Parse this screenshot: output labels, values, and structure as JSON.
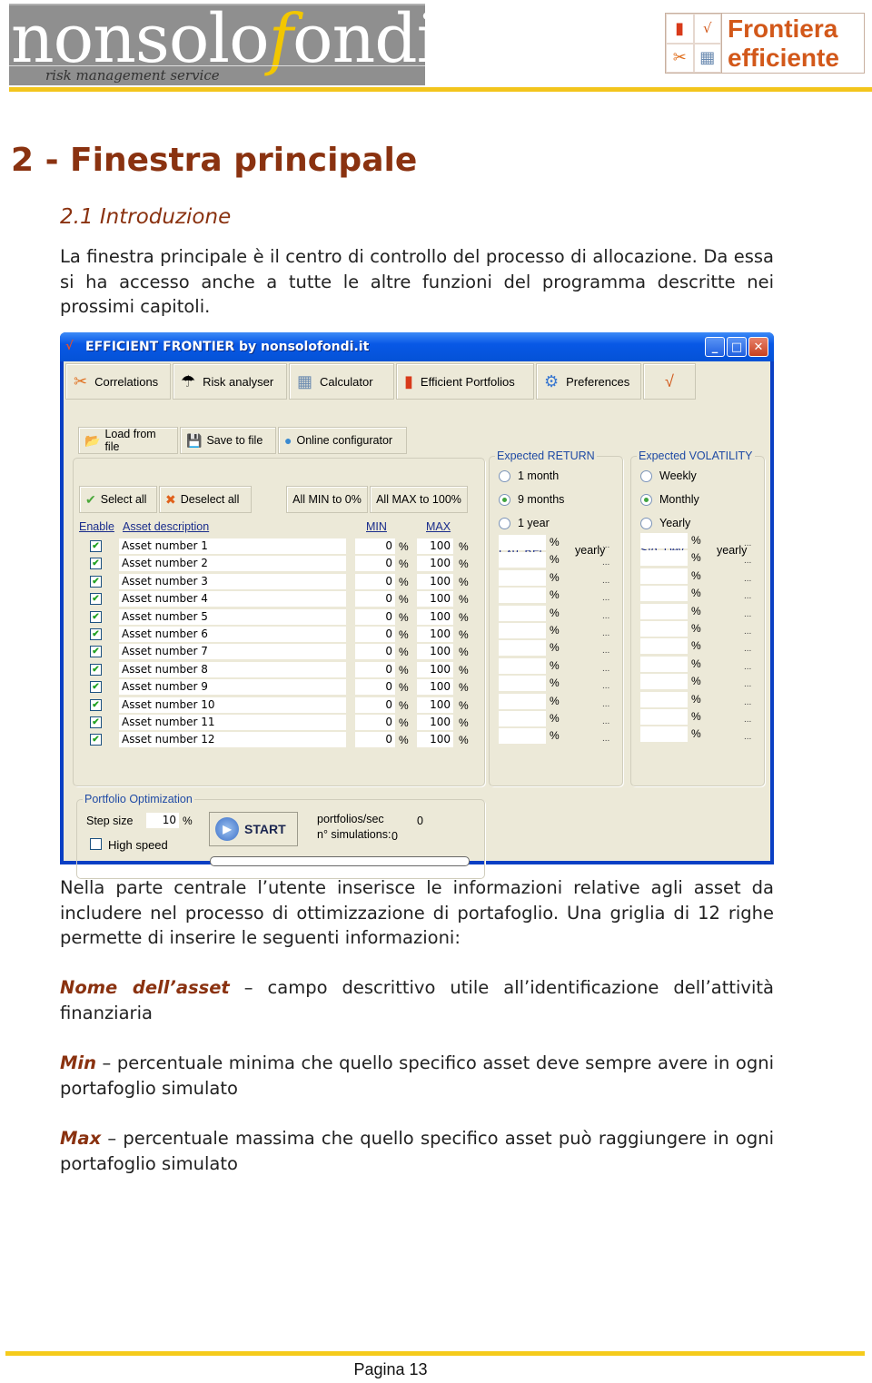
{
  "header": {
    "logo_left": {
      "brand_part1": "nonsolo",
      "brand_f": "f",
      "brand_part2": "ondi",
      "tagline": "risk management service"
    },
    "logo_right": {
      "line1": "Frontiera",
      "line2": "efficiente",
      "icons": [
        "chart-icon",
        "sqrt-icon",
        "tools-icon",
        "calculator-icon"
      ]
    }
  },
  "document": {
    "chapter_title": "2 - Finestra principale",
    "section_title": "2.1 Introduzione",
    "intro_paragraph": "La finestra principale è il centro di controllo del processo di allocazione. Da essa si ha accesso anche a tutte le altre funzioni del programma descritte nei prossimi capitoli.",
    "body_paragraph": "Nella parte centrale l’utente inserisce le informazioni relative agli asset da includere nel processo di ottimizzazione di portafoglio. Una griglia di 12 righe permette di inserire le seguenti informazioni:",
    "definitions": [
      {
        "term": "Nome dell’asset",
        "text": " – campo descrittivo utile all’identificazione dell’attività finanziaria"
      },
      {
        "term": "Min",
        "text": " – percentuale minima che quello specifico asset deve sempre avere in ogni portafoglio simulato"
      },
      {
        "term": "Max",
        "text": " – percentuale massima che quello specifico asset può raggiungere in ogni portafoglio simulato"
      }
    ],
    "page_label": "Pagina 13"
  },
  "app_window": {
    "title": "EFFICIENT FRONTIER by nonsolofondi.it",
    "toolbar": [
      {
        "label": "Correlations",
        "icon": "tools-icon"
      },
      {
        "label": "Risk analyser",
        "icon": "umbrella-icon"
      },
      {
        "label": "Calculator",
        "icon": "calculator-icon"
      },
      {
        "label": "Efficient Portfolios",
        "icon": "chart-icon"
      },
      {
        "label": "Preferences",
        "icon": "preferences-icon"
      },
      {
        "label": "",
        "icon": "sqrt-icon"
      }
    ],
    "file_buttons": {
      "load": "Load from file",
      "save": "Save to file",
      "online": "Online configurator"
    },
    "grid_buttons": {
      "select_all": "Select all",
      "deselect_all": "Deselect all",
      "all_min": "All MIN to 0%",
      "all_max": "All MAX to 100%"
    },
    "columns": {
      "enable": "Enable",
      "description": "Asset description",
      "min": "MIN",
      "max": "MAX"
    },
    "pct_symbol": "%",
    "ellipsis": "...",
    "assets": [
      {
        "enabled": true,
        "name": "Asset number 1",
        "min": "0",
        "max": "100",
        "exp_ret": "",
        "std_dev": ""
      },
      {
        "enabled": true,
        "name": "Asset number 2",
        "min": "0",
        "max": "100",
        "exp_ret": "",
        "std_dev": ""
      },
      {
        "enabled": true,
        "name": "Asset number 3",
        "min": "0",
        "max": "100",
        "exp_ret": "",
        "std_dev": ""
      },
      {
        "enabled": true,
        "name": "Asset number 4",
        "min": "0",
        "max": "100",
        "exp_ret": "",
        "std_dev": ""
      },
      {
        "enabled": true,
        "name": "Asset number 5",
        "min": "0",
        "max": "100",
        "exp_ret": "",
        "std_dev": ""
      },
      {
        "enabled": true,
        "name": "Asset number 6",
        "min": "0",
        "max": "100",
        "exp_ret": "",
        "std_dev": ""
      },
      {
        "enabled": true,
        "name": "Asset number 7",
        "min": "0",
        "max": "100",
        "exp_ret": "",
        "std_dev": ""
      },
      {
        "enabled": true,
        "name": "Asset number 8",
        "min": "0",
        "max": "100",
        "exp_ret": "",
        "std_dev": ""
      },
      {
        "enabled": true,
        "name": "Asset number 9",
        "min": "0",
        "max": "100",
        "exp_ret": "",
        "std_dev": ""
      },
      {
        "enabled": true,
        "name": "Asset number 10",
        "min": "0",
        "max": "100",
        "exp_ret": "",
        "std_dev": ""
      },
      {
        "enabled": true,
        "name": "Asset number 11",
        "min": "0",
        "max": "100",
        "exp_ret": "",
        "std_dev": ""
      },
      {
        "enabled": true,
        "name": "Asset number 12",
        "min": "0",
        "max": "100",
        "exp_ret": "",
        "std_dev": ""
      }
    ],
    "expected_return": {
      "group_label": "Expected RETURN",
      "options": [
        {
          "label": "1 month",
          "selected": false
        },
        {
          "label": "9 months",
          "selected": true
        },
        {
          "label": "1 year",
          "selected": false
        }
      ],
      "column_label": "Exp. Ret.",
      "unit_label": "yearly"
    },
    "expected_volatility": {
      "group_label": "Expected VOLATILITY",
      "options": [
        {
          "label": "Weekly",
          "selected": false
        },
        {
          "label": "Monthly",
          "selected": true
        },
        {
          "label": "Yearly",
          "selected": false
        }
      ],
      "column_label": "Std. Dev",
      "unit_label": "yearly"
    },
    "optimization": {
      "group_label": "Portfolio Optimization",
      "step_size_label": "Step size",
      "step_size_value": "10",
      "high_speed_label": "High speed",
      "high_speed_checked": false,
      "start_label": "START",
      "portfolios_sec_label": "portfolios/sec",
      "portfolios_sec_value": "0",
      "simulations_label": "n° simulations:",
      "simulations_value": "0",
      "progress": 0
    }
  }
}
